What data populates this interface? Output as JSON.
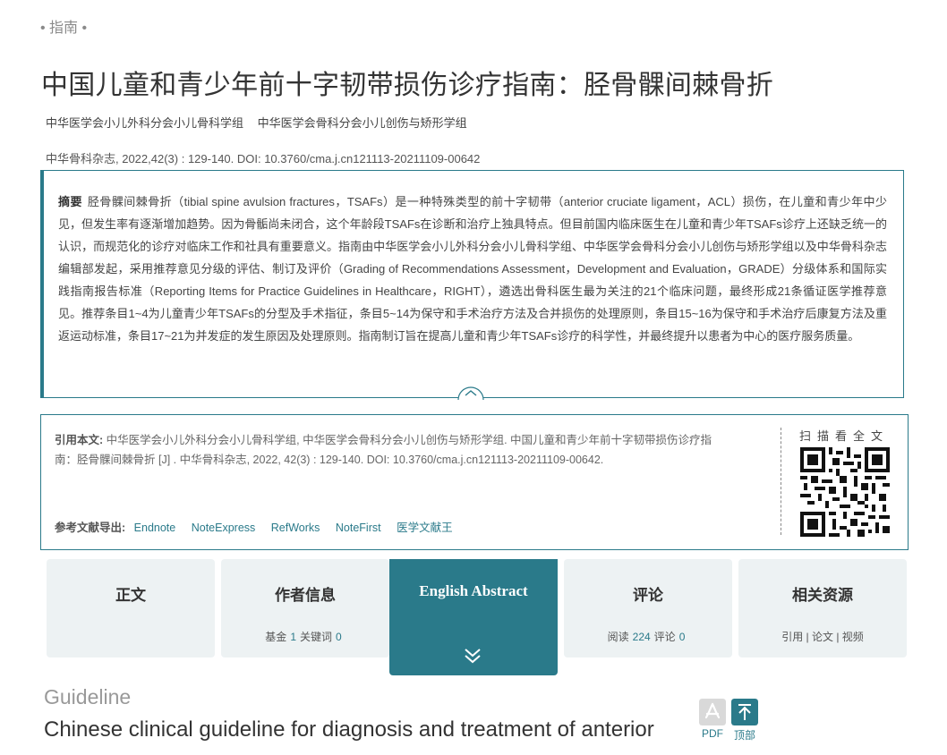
{
  "header": {
    "section_tag": "• 指南 •",
    "title": "中国儿童和青少年前十字韧带损伤诊疗指南：胫骨髁间棘骨折",
    "authors": [
      "中华医学会小儿外科分会小儿骨科学组",
      "中华医学会骨科分会小儿创伤与矫形学组"
    ],
    "citation": "中华骨科杂志, 2022,42(3) : 129-140. DOI: 10.3760/cma.j.cn121113-20211109-00642"
  },
  "abstract": {
    "label": "摘要",
    "text": "胫骨髁间棘骨折（tibial spine avulsion fractures，TSAFs）是一种特殊类型的前十字韧带（anterior cruciate ligament，ACL）损伤，在儿童和青少年中少见，但发生率有逐渐增加趋势。因为骨骺尚未闭合，这个年龄段TSAFs在诊断和治疗上独具特点。但目前国内临床医生在儿童和青少年TSAFs诊疗上还缺乏统一的认识，而规范化的诊疗对临床工作和社具有重要意义。指南由中华医学会小儿外科分会小儿骨科学组、中华医学会骨科分会小儿创伤与矫形学组以及中华骨科杂志编辑部发起，采用推荐意见分级的评估、制订及评价（Grading of Recommendations Assessment，Development and Evaluation，GRADE）分级体系和国际实践指南报告标准（Reporting Items for Practice Guidelines in Healthcare，RIGHT），遴选出骨科医生最为关注的21个临床问题，最终形成21条循证医学推荐意见。推荐条目1~4为儿童青少年TSAFs的分型及手术指征，条目5~14为保守和手术治疗方法及合并损伤的处理原则，条目15~16为保守和手术治疗后康复方法及重返运动标准，条目17~21为并发症的发生原因及处理原则。指南制订旨在提高儿童和青少年TSAFs诊疗的科学性，并最终提升以患者为中心的医疗服务质量。"
  },
  "cite": {
    "label": "引用本文:",
    "text": "中华医学会小儿外科分会小儿骨科学组, 中华医学会骨科分会小儿创伤与矫形学组. 中国儿童和青少年前十字韧带损伤诊疗指南：胫骨髁间棘骨折 [J] . 中华骨科杂志, 2022, 42(3) : 129-140. DOI: 10.3760/cma.j.cn121113-20211109-00642.",
    "export_label": "参考文献导出:",
    "export_links": [
      "Endnote",
      "NoteExpress",
      "RefWorks",
      "NoteFirst",
      "医学文献王"
    ],
    "qr_label": "扫描看全文"
  },
  "tabs": [
    {
      "title": "正文",
      "sub": []
    },
    {
      "title": "作者信息",
      "sub": [
        {
          "k": "基金",
          "v": "1"
        },
        {
          "k": "关键词",
          "v": "0"
        }
      ]
    },
    {
      "title": "English Abstract",
      "sub": []
    },
    {
      "title": "评论",
      "sub": [
        {
          "k": "阅读",
          "v": "224"
        },
        {
          "k": "评论",
          "v": "0"
        }
      ]
    },
    {
      "title": "相关资源",
      "sub_text": "引用 | 论文 | 视频"
    }
  ],
  "english": {
    "tag": "Guideline",
    "title": "Chinese clinical guideline for diagnosis and treatment of anterior"
  },
  "side": {
    "pdf_label": "PDF",
    "top_label": "顶部"
  },
  "colors": {
    "accent": "#2a7a8a",
    "tab_bg": "#edf2f3"
  }
}
